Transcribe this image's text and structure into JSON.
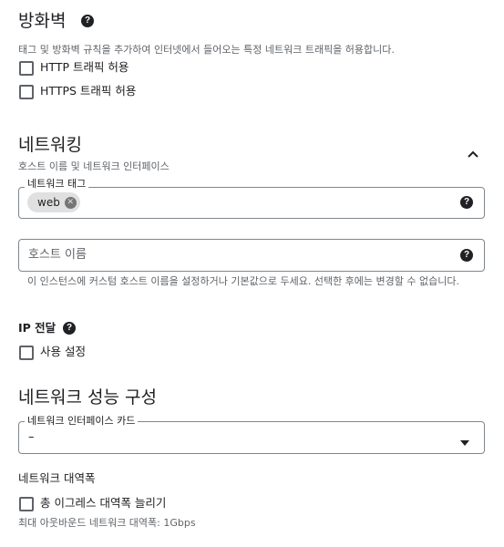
{
  "firewall": {
    "title": "방화벽",
    "description": "태그 및 방화벽 규칙을 추가하여 인터넷에서 들어오는 특정 네트워크 트래픽을 허용합니다.",
    "options": [
      {
        "label": "HTTP 트래픽 허용",
        "checked": false
      },
      {
        "label": "HTTPS 트래픽 허용",
        "checked": false
      }
    ]
  },
  "networking": {
    "title": "네트워킹",
    "subtitle": "호스트 이름 및 네트워크 인터페이스",
    "tags_field": {
      "label": "네트워크 태그",
      "chips": [
        "web"
      ]
    },
    "hostname_field": {
      "placeholder": "호스트 이름",
      "hint": "이 인스턴스에 커스텀 호스트 이름을 설정하거나 기본값으로 두세요. 선택한 후에는 변경할 수 없습니다."
    },
    "ip_forwarding": {
      "label": "IP 전달",
      "option_label": "사용 설정",
      "checked": false
    }
  },
  "performance": {
    "title": "네트워크 성능 구성",
    "nic_field": {
      "label": "네트워크 인터페이스 카드",
      "value": "–"
    },
    "bandwidth": {
      "label": "네트워크 대역폭",
      "option_label": "총 이그레스 대역폭 늘리기",
      "checked": false,
      "hint": "최대 아웃바운드 네트워크 대역폭: 1Gbps"
    }
  },
  "icons": {
    "help": "help-circle-icon",
    "collapse": "chevron-up-icon",
    "dropdown": "dropdown-arrow-icon",
    "chip_remove": "cancel-circle-icon"
  }
}
